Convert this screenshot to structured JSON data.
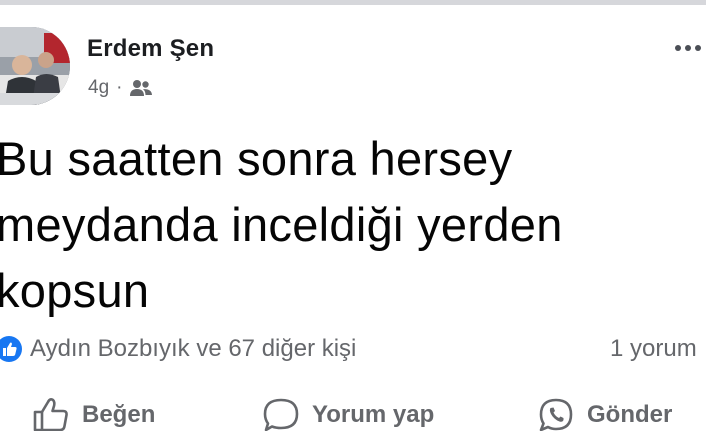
{
  "post": {
    "author": "Erdem Şen",
    "time": "4g",
    "separator": "·",
    "audience_icon": "friends-icon",
    "text": "Bu saatten sonra hersey\nmeydanda inceldiği yerden\nkopsun"
  },
  "engagement": {
    "reaction_icon": "like-reaction-icon",
    "reactions_text": "Aydın Bozbıyık ve 67 diğer kişi",
    "comments_text": "1 yorum"
  },
  "actions": {
    "like_label": "Beğen",
    "comment_label": "Yorum yap",
    "send_label": "Gönder"
  },
  "colors": {
    "text_primary": "#050505",
    "text_secondary": "#65676b",
    "like_blue": "#1877f2"
  }
}
